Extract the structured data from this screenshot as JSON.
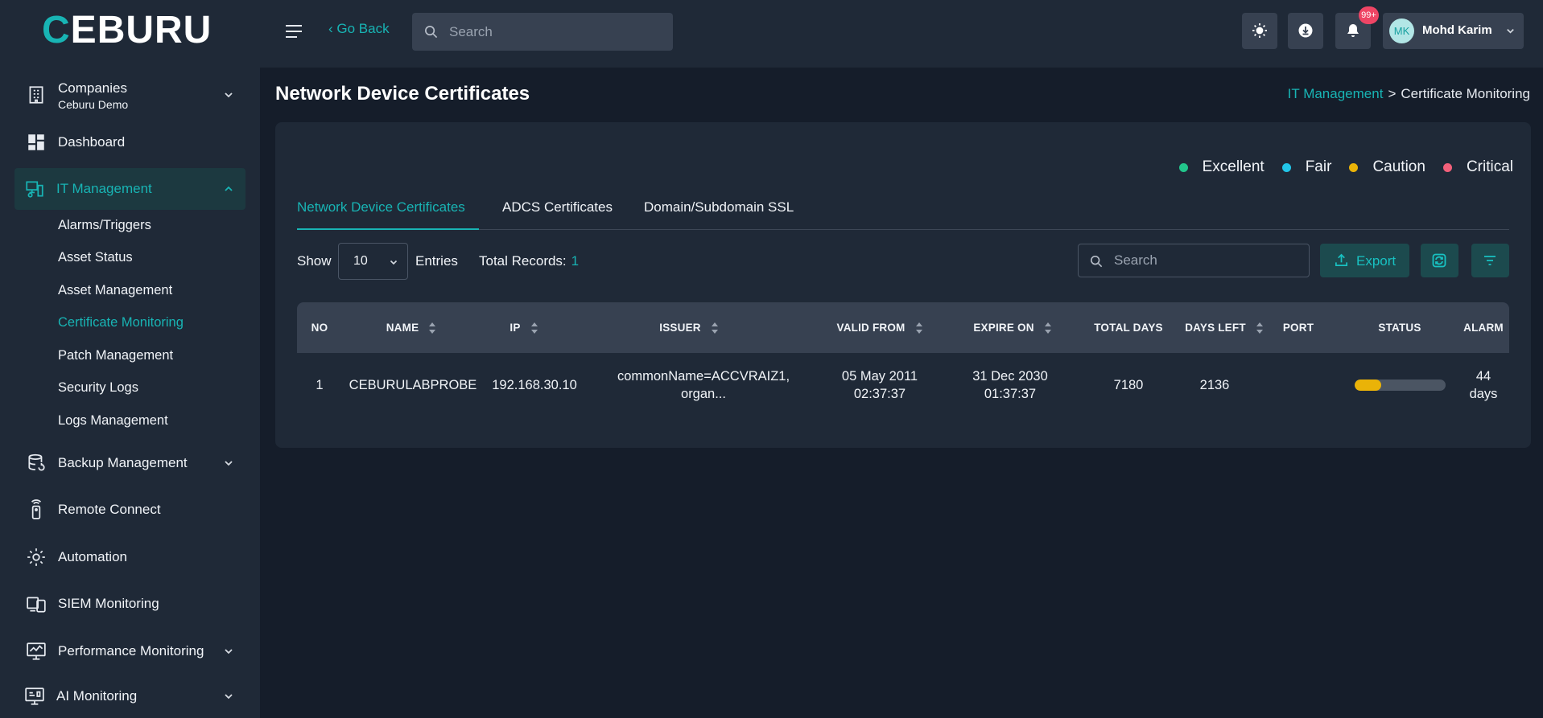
{
  "brand": {
    "logo_first": "C",
    "logo_rest": "EBURU"
  },
  "sidebar": {
    "company": {
      "label": "Companies",
      "sub": "Ceburu Demo"
    },
    "items": [
      {
        "label": "Dashboard",
        "icon": "dashboard-icon"
      },
      {
        "label": "IT Management",
        "icon": "it-management-icon"
      },
      {
        "label": "Backup Management",
        "icon": "database-icon"
      },
      {
        "label": "Remote Connect",
        "icon": "remote-icon"
      },
      {
        "label": "Automation",
        "icon": "gear-icon"
      },
      {
        "label": "SIEM Monitoring",
        "icon": "devices-icon"
      },
      {
        "label": "Performance Monitoring",
        "icon": "monitor-chart-icon"
      },
      {
        "label": "AI Monitoring",
        "icon": "ai-monitor-icon"
      }
    ],
    "sub_items": [
      "Alarms/Triggers",
      "Asset Status",
      "Asset Management",
      "Certificate Monitoring",
      "Patch Management",
      "Security Logs",
      "Logs Management"
    ]
  },
  "topbar": {
    "go_back": "‹ Go Back",
    "search_placeholder": "Search",
    "notifications_badge": "99+",
    "user_initials": "MK",
    "user_name": "Mohd Karim"
  },
  "page": {
    "title": "Network Device Certificates",
    "breadcrumb": {
      "parent": "IT Management",
      "separator": ">",
      "current": "Certificate Monitoring"
    }
  },
  "legend": [
    {
      "label": "Excellent",
      "color": "#22c58b"
    },
    {
      "label": "Fair",
      "color": "#22c5e8"
    },
    {
      "label": "Caution",
      "color": "#eab308"
    },
    {
      "label": "Critical",
      "color": "#f2607a"
    }
  ],
  "tabs": [
    "Network Device Certificates",
    "ADCS Certificates",
    "Domain/Subdomain SSL"
  ],
  "controls": {
    "show_label": "Show",
    "page_size": "10",
    "entries_label": "Entries",
    "total_label": "Total Records:",
    "total_value": "1",
    "search_placeholder": "Search",
    "export_label": "Export"
  },
  "table": {
    "headers": [
      "NO",
      "NAME",
      "IP",
      "ISSUER",
      "VALID FROM",
      "EXPIRE ON",
      "TOTAL DAYS",
      "DAYS LEFT",
      "PORT",
      "STATUS",
      "ALARM"
    ],
    "rows": [
      {
        "no": "1",
        "name": "CEBURULABPROBE",
        "ip": "192.168.30.10",
        "issuer_1": "commonName=ACCVRAIZ1,",
        "issuer_2": "organ...",
        "valid_from_1": "05 May 2011",
        "valid_from_2": "02:37:37",
        "expire_on_1": "31 Dec 2030",
        "expire_on_2": "01:37:37",
        "total_days": "7180",
        "days_left": "2136",
        "port": "",
        "status_fraction": 0.3,
        "status_color": "#eab308",
        "alarm_1": "44",
        "alarm_2": "days"
      }
    ]
  }
}
